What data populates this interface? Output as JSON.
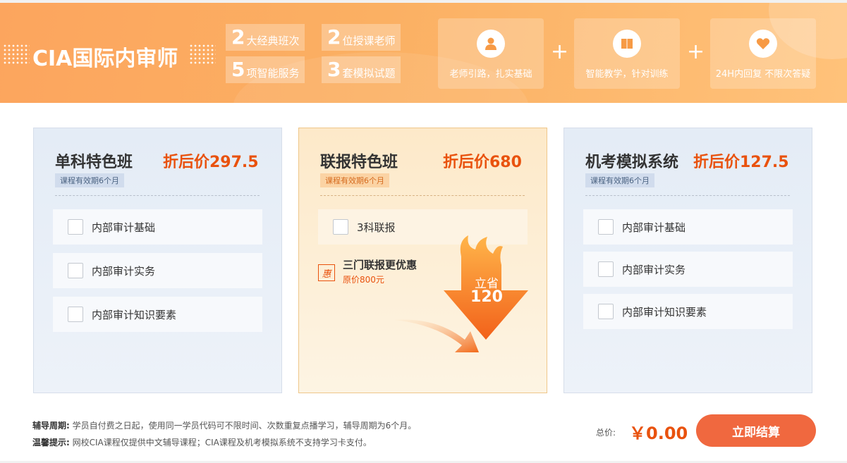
{
  "banner": {
    "title": "CIA国际内审师",
    "stats": [
      {
        "num": "2",
        "text": "大经典班次"
      },
      {
        "num": "2",
        "text": "位授课老师"
      },
      {
        "num": "5",
        "text": "项智能服务"
      },
      {
        "num": "3",
        "text": "套模拟试题"
      }
    ],
    "features": [
      {
        "icon": "teacher-icon",
        "text": "老师引路，扎实基础"
      },
      {
        "icon": "book-icon",
        "text": "智能教学，针对训练"
      },
      {
        "icon": "heart-icon",
        "text": "24H内回复 不限次答疑"
      }
    ],
    "plus": "+"
  },
  "cards": [
    {
      "title": "单科特色班",
      "price": "折后价297.5",
      "validity": "课程有效期6个月",
      "options": [
        "内部审计基础",
        "内部审计实务",
        "内部审计知识要素"
      ]
    },
    {
      "title": "联报特色班",
      "price": "折后价680",
      "validity": "课程有效期6个月",
      "options": [
        "3科联报"
      ],
      "deal": {
        "badge": "惠",
        "title": "三门联报更优惠",
        "sub": "原价800元",
        "save_label": "立省",
        "save_amount": "120"
      }
    },
    {
      "title": "机考模拟系统",
      "price": "折后价127.5",
      "validity": "课程有效期6个月",
      "options": [
        "内部审计基础",
        "内部审计实务",
        "内部审计知识要素"
      ]
    }
  ],
  "footer": {
    "period_label": "辅导周期:",
    "period_text": "学员自付费之日起，使用同一学员代码可不限时间、次数重复点播学习，辅导周期为6个月。",
    "tip_label": "温馨提示:",
    "tip_text": "网校CIA课程仅提供中文辅导课程；CIA课程及机考模拟系统不支持学习卡支付。",
    "total_label": "总价:",
    "total_value": "￥0.00",
    "checkout_label": "立即结算"
  },
  "colors": {
    "accent": "#e9520e",
    "banner": "#fca55e",
    "checkout": "#f0683f"
  }
}
